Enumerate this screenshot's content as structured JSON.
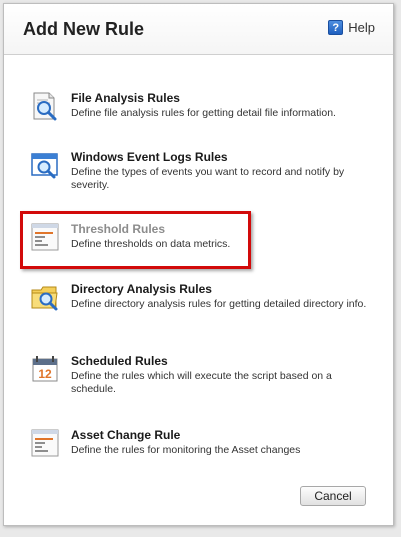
{
  "dialog": {
    "title": "Add New Rule",
    "help_label": "Help",
    "help_icon_glyph": "?",
    "cancel_label": "Cancel"
  },
  "rules": [
    {
      "title": "File Analysis Rules",
      "description": "Define file analysis rules for getting detail file information.",
      "icon": "file-analysis-magnifier-icon",
      "highlighted": false
    },
    {
      "title": "Windows Event Logs Rules",
      "description": "Define the types of events you want to record and notify by severity.",
      "icon": "event-log-window-magnifier-icon",
      "highlighted": false
    },
    {
      "title": "Threshold Rules",
      "description": "Define thresholds on data metrics.",
      "icon": "threshold-chart-icon",
      "highlighted": true
    },
    {
      "title": "Directory Analysis Rules",
      "description": "Define directory analysis rules for getting detailed directory info.",
      "icon": "folder-magnifier-icon",
      "highlighted": false
    },
    {
      "title": "Scheduled Rules",
      "description": "Define the rules which will execute the script based on a schedule.",
      "icon": "calendar-icon",
      "highlighted": false
    },
    {
      "title": "Asset Change Rule",
      "description": "Define the rules for monitoring the Asset changes",
      "icon": "asset-change-chart-icon",
      "highlighted": false
    }
  ],
  "calendar_day": "12",
  "colors": {
    "highlight_border": "#d20a0a",
    "disabled_title": "#8c8c8c"
  }
}
